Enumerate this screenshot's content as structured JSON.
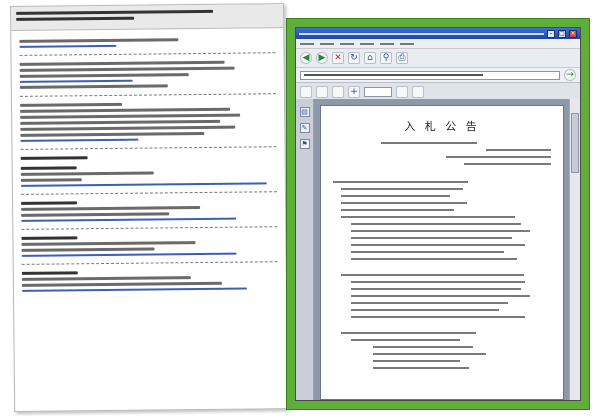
{
  "browser": {
    "titlebar": {
      "minimize_glyph": "–",
      "maximize_glyph": "□",
      "close_glyph": "×"
    },
    "toolbar": {
      "back_glyph": "◀",
      "forward_glyph": "▶",
      "stop_glyph": "✕",
      "refresh_glyph": "↻",
      "home_glyph": "⌂",
      "search_glyph": "⚲",
      "print_glyph": "⎙"
    },
    "address": {
      "go_glyph": "→"
    },
    "pdf_toolbar": {
      "zoom_glyph": "+"
    },
    "sidepanel": {
      "icons": [
        "▤",
        "✎",
        "⚑"
      ]
    }
  },
  "document": {
    "heading": "入 札 公 告"
  },
  "colors": {
    "frame_green": "#5fae3a",
    "titlebar_blue": "#1e46b0",
    "link_blue": "#3b5fb8"
  }
}
